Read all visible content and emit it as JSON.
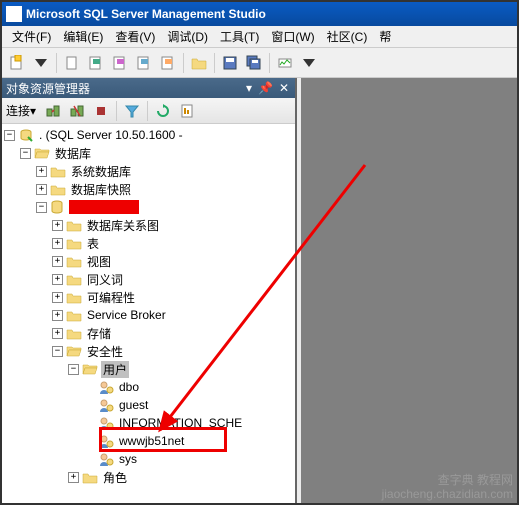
{
  "title": "Microsoft SQL Server Management Studio",
  "menus": {
    "file": "文件(F)",
    "edit": "编辑(E)",
    "view": "查看(V)",
    "debug": "调试(D)",
    "tools": "工具(T)",
    "window": "窗口(W)",
    "community": "社区(C)",
    "help": "帮"
  },
  "panel": {
    "title": "对象资源管理器",
    "connect_label": "连接▾"
  },
  "tree": {
    "root": ". (SQL Server 10.50.1600 - ",
    "databases": "数据库",
    "sys_databases": "系统数据库",
    "db_snapshots": "数据库快照",
    "redacted_db": " ",
    "db_diagrams": "数据库关系图",
    "tables": "表",
    "views": "视图",
    "synonyms": "同义词",
    "programmability": "可编程性",
    "service_broker": "Service Broker",
    "storage": "存储",
    "security": "安全性",
    "users": "用户",
    "u_dbo": "dbo",
    "u_guest": "guest",
    "u_info": "INFORMATION_SCHE",
    "u_target": "wwwjb51net",
    "u_sys": "sys",
    "roles": "角色"
  },
  "watermark": {
    "line1": "查字典 教程网",
    "line2": "jiaocheng.chazidian.com"
  }
}
